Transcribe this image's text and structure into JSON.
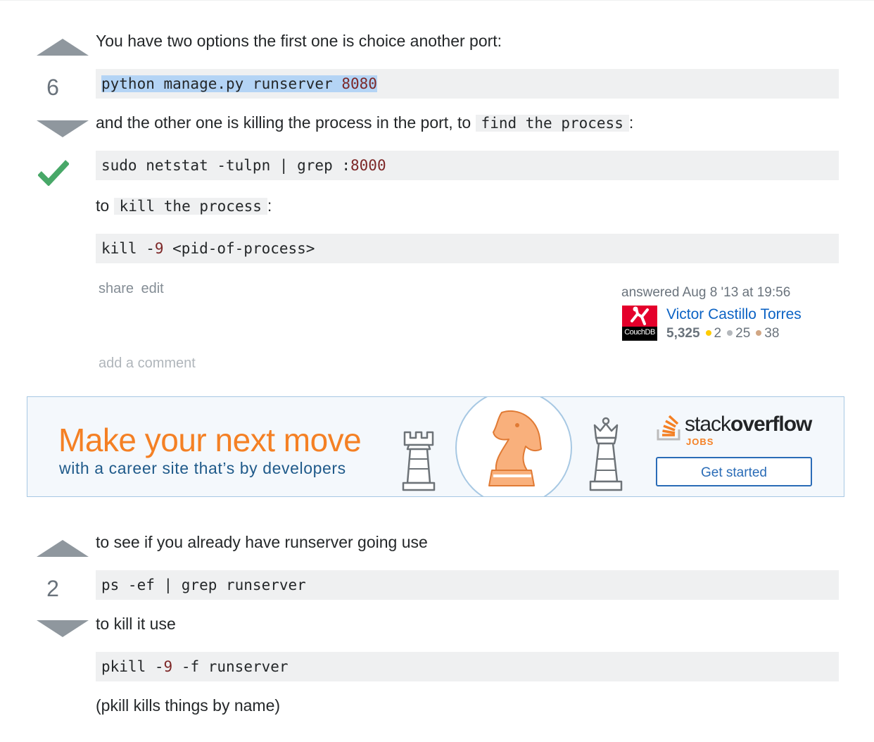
{
  "answer1": {
    "score": "6",
    "intro_text": "You have two options the first one is choice another port:",
    "code1": {
      "cmd": "python manage.py runserver ",
      "num": "8080"
    },
    "text2_before": "and the other one is killing the process in the port, to ",
    "text2_code": "find the process",
    "text2_after": ":",
    "code2": {
      "cmd": "sudo netstat -tulpn | grep :",
      "num": "8000"
    },
    "text3_before": "to ",
    "text3_code": "kill the process",
    "text3_after": ":",
    "code3": {
      "cmd1": "kill -",
      "num": "9",
      "cmd2": " <pid-of-process>"
    },
    "menu": {
      "share": "share",
      "edit": "edit"
    },
    "answered": "answered Aug 8 '13 at 19:56",
    "user": {
      "name": "Victor Castillo Torres",
      "avatar_text": "CouchDB",
      "reputation": "5,325",
      "gold": "2",
      "silver": "25",
      "bronze": "38"
    },
    "add_comment": "add a comment"
  },
  "ad": {
    "headline": "Make your next move",
    "subline": "with a career site that’s by developers",
    "logo_light": "stack",
    "logo_bold": "overflow",
    "logo_jobs": "JOBS",
    "button": "Get started"
  },
  "answer2": {
    "score": "2",
    "text1": "to see if you already have runserver going use",
    "code1": "ps -ef | grep runserver",
    "text2": "to kill it use",
    "code2": {
      "cmd1": "pkill -",
      "num": "9",
      "cmd2": " -f runserver"
    },
    "text3": "(pkill kills things by name)"
  },
  "colors": {
    "accepted": "#48a868",
    "vote_arrow": "#8f979e",
    "link": "#0c63c4",
    "ad_orange": "#f48024",
    "code_bg": "#eff0f1",
    "selection": "#b4d4f5"
  },
  "icons": [
    "vote-up-icon",
    "vote-down-icon",
    "accepted-checkmark-icon",
    "chess-rook-icon",
    "chess-knight-icon",
    "chess-queen-icon",
    "stackoverflow-logo-icon"
  ]
}
